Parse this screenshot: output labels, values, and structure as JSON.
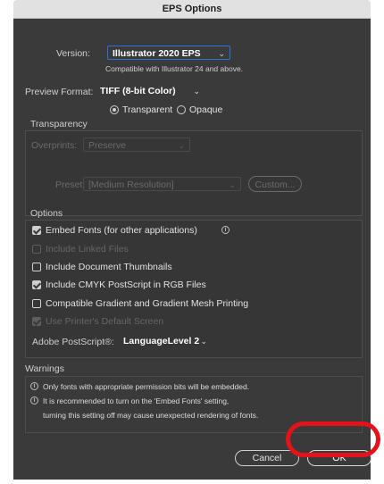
{
  "window": {
    "title": "EPS Options"
  },
  "version": {
    "label": "Version:",
    "value": "Illustrator 2020 EPS",
    "note": "Compatible with Illustrator 24 and above."
  },
  "preview": {
    "label": "Preview Format:",
    "value": "TIFF (8-bit Color)",
    "options": [
      "Transparent",
      "Opaque"
    ],
    "selected": "Transparent"
  },
  "transparency": {
    "title": "Transparency",
    "overprints_label": "Overprints:",
    "overprints_value": "Preserve",
    "preset_label": "Preset:",
    "preset_value": "[Medium Resolution]",
    "custom_label": "Custom..."
  },
  "options": {
    "title": "Options",
    "items": [
      {
        "label": "Embed Fonts (for other applications)",
        "checked": true,
        "enabled": true
      },
      {
        "label": "Include Linked Files",
        "checked": false,
        "enabled": false
      },
      {
        "label": "Include Document Thumbnails",
        "checked": false,
        "enabled": true
      },
      {
        "label": "Include CMYK PostScript in RGB Files",
        "checked": true,
        "enabled": true
      },
      {
        "label": "Compatible Gradient and Gradient Mesh Printing",
        "checked": false,
        "enabled": true
      },
      {
        "label": "Use Printer's Default Screen",
        "checked": true,
        "enabled": false
      }
    ],
    "postscript_label": "Adobe PostScript®:",
    "postscript_value": "LanguageLevel 2"
  },
  "warnings": {
    "title": "Warnings",
    "lines": [
      "Only fonts with appropriate permission bits will be embedded.",
      "It is recommended to turn on the 'Embed Fonts' setting,",
      "turning this setting off may cause unexpected rendering of fonts."
    ]
  },
  "buttons": {
    "cancel": "Cancel",
    "ok": "OK"
  },
  "colors": {
    "dialog_bg": "#3a3a3a",
    "highlight": "#e4121b",
    "focus_blue": "#2f6fd8"
  },
  "icons": {
    "info": "info-circle-icon",
    "chevron": "chevron-down-icon"
  }
}
